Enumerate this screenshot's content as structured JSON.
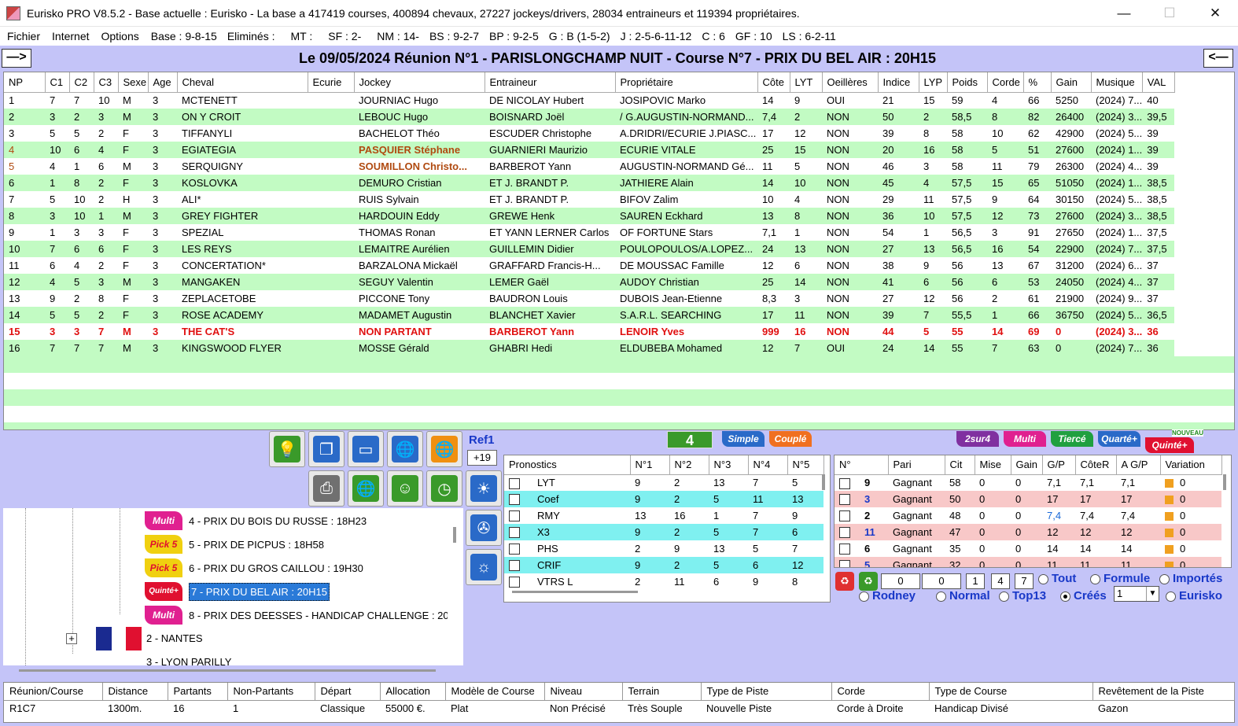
{
  "app": {
    "title": "Eurisko PRO V8.5.2 - Base actuelle : Eurisko - La base a 417419 courses, 400894 chevaux, 27227 jockeys/drivers, 28034 entraineurs et 119394 propriétaires.",
    "min": "—",
    "max": "☐",
    "close": "✕"
  },
  "menu": {
    "fichier": "Fichier",
    "internet": "Internet",
    "options": "Options",
    "stats": [
      "Base : 9-8-15",
      "Eliminés :",
      "MT :",
      "SF : 2-",
      "NM : 14-",
      "BS : 9-2-7",
      "BP : 9-2-5",
      "G : B (1-5-2)",
      "J : 2-5-6-11-12",
      "C : 6",
      "GF : 10",
      "LS : 6-2-11"
    ]
  },
  "race": {
    "prev": "—>",
    "next": "<—",
    "title": "Le 09/05/2024 Réunion N°1 - PARISLONGCHAMP NUIT - Course N°7 - PRIX DU BEL AIR : 20H15"
  },
  "grid": {
    "columns": [
      "NP",
      "C1",
      "C2",
      "C3",
      "Sexe",
      "Age",
      "Cheval",
      "Ecurie",
      "Jockey",
      "Entraineur",
      "Propriétaire",
      "Côte",
      "LYT",
      "Oeillères",
      "Indice",
      "LYP",
      "Poids",
      "Corde",
      "%",
      "Gain",
      "Musique",
      "VAL"
    ],
    "rows": [
      [
        "1",
        "7",
        "7",
        "10",
        "M",
        "3",
        "MCTENETT",
        "",
        "JOURNIAC Hugo",
        "DE NICOLAY Hubert",
        "JOSIPOVIC Marko",
        "14",
        "9",
        "OUI",
        "21",
        "15",
        "59",
        "4",
        "66",
        "5250",
        "(2024) 7...",
        "40"
      ],
      [
        "2",
        "3",
        "2",
        "3",
        "M",
        "3",
        "ON Y CROIT",
        "",
        "LEBOUC Hugo",
        "BOISNARD Joël",
        "/ G.AUGUSTIN-NORMAND...",
        "7,4",
        "2",
        "NON",
        "50",
        "2",
        "58,5",
        "8",
        "82",
        "26400",
        "(2024) 3...",
        "39,5"
      ],
      [
        "3",
        "5",
        "5",
        "2",
        "F",
        "3",
        "TIFFANYLI",
        "",
        "BACHELOT Théo",
        "ESCUDER Christophe",
        "A.DRIDRI/ECURIE J.PIASC...",
        "17",
        "12",
        "NON",
        "39",
        "8",
        "58",
        "10",
        "62",
        "42900",
        "(2024) 5...",
        "39"
      ],
      [
        "4",
        "10",
        "6",
        "4",
        "F",
        "3",
        "EGIATEGIA",
        "",
        "PASQUIER Stéphane",
        "GUARNIERI Maurizio",
        "ECURIE VITALE",
        "25",
        "15",
        "NON",
        "20",
        "16",
        "58",
        "5",
        "51",
        "27600",
        "(2024) 1...",
        "39"
      ],
      [
        "5",
        "4",
        "1",
        "6",
        "M",
        "3",
        "SERQUIGNY",
        "",
        "SOUMILLON Christo...",
        "BARBEROT Yann",
        "AUGUSTIN-NORMAND Gé...",
        "11",
        "5",
        "NON",
        "46",
        "3",
        "58",
        "11",
        "79",
        "26300",
        "(2024) 4...",
        "39"
      ],
      [
        "6",
        "1",
        "8",
        "2",
        "F",
        "3",
        "KOSLOVKA",
        "",
        "DEMURO Cristian",
        "ET J. BRANDT P.",
        "JATHIERE Alain",
        "14",
        "10",
        "NON",
        "45",
        "4",
        "57,5",
        "15",
        "65",
        "51050",
        "(2024) 1...",
        "38,5"
      ],
      [
        "7",
        "5",
        "10",
        "2",
        "H",
        "3",
        "ALI*",
        "",
        "RUIS Sylvain",
        "ET J. BRANDT P.",
        "BIFOV Zalim",
        "10",
        "4",
        "NON",
        "29",
        "11",
        "57,5",
        "9",
        "64",
        "30150",
        "(2024) 5...",
        "38,5"
      ],
      [
        "8",
        "3",
        "10",
        "1",
        "M",
        "3",
        "GREY FIGHTER",
        "",
        "HARDOUIN Eddy",
        "GREWE Henk",
        "SAUREN Eckhard",
        "13",
        "8",
        "NON",
        "36",
        "10",
        "57,5",
        "12",
        "73",
        "27600",
        "(2024) 3...",
        "38,5"
      ],
      [
        "9",
        "1",
        "3",
        "3",
        "F",
        "3",
        "SPEZIAL",
        "",
        "THOMAS Ronan",
        "ET YANN LERNER Carlos",
        "OF FORTUNE Stars",
        "7,1",
        "1",
        "NON",
        "54",
        "1",
        "56,5",
        "3",
        "91",
        "27650",
        "(2024) 1...",
        "37,5"
      ],
      [
        "10",
        "7",
        "6",
        "6",
        "F",
        "3",
        "LES REYS",
        "",
        "LEMAITRE Aurélien",
        "GUILLEMIN Didier",
        "POULOPOULOS/A.LOPEZ...",
        "24",
        "13",
        "NON",
        "27",
        "13",
        "56,5",
        "16",
        "54",
        "22900",
        "(2024) 7...",
        "37,5"
      ],
      [
        "11",
        "6",
        "4",
        "2",
        "F",
        "3",
        "CONCERTATION*",
        "",
        "BARZALONA Mickaël",
        "GRAFFARD Francis-H...",
        "DE MOUSSAC Famille",
        "12",
        "6",
        "NON",
        "38",
        "9",
        "56",
        "13",
        "67",
        "31200",
        "(2024) 6...",
        "37"
      ],
      [
        "12",
        "4",
        "5",
        "3",
        "M",
        "3",
        "MANGAKEN",
        "",
        "SEGUY Valentin",
        "LEMER Gaël",
        "AUDOY Christian",
        "25",
        "14",
        "NON",
        "41",
        "6",
        "56",
        "6",
        "53",
        "24050",
        "(2024) 4...",
        "37"
      ],
      [
        "13",
        "9",
        "2",
        "8",
        "F",
        "3",
        "ZEPLACETOBE",
        "",
        "PICCONE Tony",
        "BAUDRON Louis",
        "DUBOIS Jean-Etienne",
        "8,3",
        "3",
        "NON",
        "27",
        "12",
        "56",
        "2",
        "61",
        "21900",
        "(2024) 9...",
        "37"
      ],
      [
        "14",
        "5",
        "5",
        "2",
        "F",
        "3",
        "ROSE ACADEMY",
        "",
        "MADAMET Augustin",
        "BLANCHET Xavier",
        "S.A.R.L. SEARCHING",
        "17",
        "11",
        "NON",
        "39",
        "7",
        "55,5",
        "1",
        "66",
        "36750",
        "(2024) 5...",
        "36,5"
      ],
      [
        "15",
        "3",
        "3",
        "7",
        "M",
        "3",
        "THE CAT'S",
        "",
        "NON PARTANT",
        "BARBEROT Yann",
        "LENOIR Yves",
        "999",
        "16",
        "NON",
        "44",
        "5",
        "55",
        "14",
        "69",
        "0",
        "(2024) 3...",
        "36"
      ],
      [
        "16",
        "7",
        "7",
        "7",
        "M",
        "3",
        "KINGSWOOD FLYER",
        "",
        "MOSSE Gérald",
        "GHABRI Hedi",
        "ELDUBEBA Mohamed",
        "12",
        "7",
        "OUI",
        "24",
        "14",
        "55",
        "7",
        "63",
        "0",
        "(2024) 7...",
        "36"
      ]
    ]
  },
  "ref": {
    "label": "Ref1",
    "value": "+19"
  },
  "bets": {
    "four": "4",
    "simple": "Simple",
    "couple": "Couplé",
    "deuxsur4": "2sur4",
    "multi": "Multi",
    "tierce": "Tiercé",
    "quarte": "Quarté+",
    "quinte": "Quinté+",
    "nouveau": "NOUVEAU"
  },
  "tree": {
    "items": [
      {
        "badge": "Multi",
        "label": "4 - PRIX DU BOIS DU RUSSE : 18H23"
      },
      {
        "badge": "Pick 5",
        "label": "5 - PRIX DE PICPUS : 18H58"
      },
      {
        "badge": "Pick 5",
        "label": "6 - PRIX DU GROS CAILLOU : 19H30"
      },
      {
        "badge": "Quinté+",
        "label": "7 - PRIX DU BEL AIR : 20H15"
      },
      {
        "badge": "Multi",
        "label": "8 - PRIX DES DEESSES - HANDICAP CHALLENGE : 20"
      }
    ],
    "meetings": [
      "2 - NANTES",
      "3 - LYON PARILLY"
    ],
    "expander": "+"
  },
  "prono": {
    "columns": [
      "Pronostics",
      "N°1",
      "N°2",
      "N°3",
      "N°4",
      "N°5"
    ],
    "rows": [
      [
        "LYT",
        "9",
        "2",
        "13",
        "7",
        "5"
      ],
      [
        "Coef",
        "9",
        "2",
        "5",
        "11",
        "13"
      ],
      [
        "RMY",
        "13",
        "16",
        "1",
        "7",
        "9"
      ],
      [
        "X3",
        "9",
        "2",
        "5",
        "7",
        "6"
      ],
      [
        "PHS",
        "2",
        "9",
        "13",
        "5",
        "7"
      ],
      [
        "CRIF",
        "9",
        "2",
        "5",
        "6",
        "12"
      ],
      [
        "VTRS L",
        "2",
        "11",
        "6",
        "9",
        "8"
      ]
    ]
  },
  "paris": {
    "columns": [
      "N°",
      "Pari",
      "Cit",
      "Mise",
      "Gain",
      "G/P",
      "CôteR",
      "A G/P",
      "Variation"
    ],
    "rows": [
      [
        "9",
        "Gagnant",
        "58",
        "0",
        "0",
        "7,1",
        "7,1",
        "7,1",
        "0"
      ],
      [
        "3",
        "Gagnant",
        "50",
        "0",
        "0",
        "17",
        "17",
        "17",
        "0"
      ],
      [
        "2",
        "Gagnant",
        "48",
        "0",
        "0",
        "7,4",
        "7,4",
        "7,4",
        "0"
      ],
      [
        "11",
        "Gagnant",
        "47",
        "0",
        "0",
        "12",
        "12",
        "12",
        "0"
      ],
      [
        "6",
        "Gagnant",
        "35",
        "0",
        "0",
        "14",
        "14",
        "14",
        "0"
      ],
      [
        "5",
        "Gagnant",
        "32",
        "0",
        "0",
        "11",
        "11",
        "11",
        "0"
      ]
    ]
  },
  "controls": {
    "v1": "0",
    "v2": "0",
    "v3": "1",
    "v4": "4",
    "v5": "7",
    "tout": "Tout",
    "formule": "Formule",
    "importes": "Importés",
    "rodney": "Rodney",
    "normal": "Normal",
    "top13": "Top13",
    "crees": "Créés",
    "select": "1",
    "eurisko": "Eurisko"
  },
  "info": {
    "columns": [
      "Réunion/Course",
      "Distance",
      "Partants",
      "Non-Partants",
      "Départ",
      "Allocation",
      "Modèle de Course",
      "Niveau",
      "Terrain",
      "Type de Piste",
      "Corde",
      "Type de Course",
      "Revêtement de la Piste"
    ],
    "values": [
      "R1C7",
      "1300m.",
      "16",
      "1",
      "Classique",
      "55000 €.",
      "Plat",
      "Non Précisé",
      "Très Souple",
      "Nouvelle Piste",
      "Corde à Droite",
      "Handicap Divisé",
      "Gazon"
    ]
  },
  "colors": {
    "green_row": "#c2fbc3",
    "cyan_row": "#7ff0f0",
    "pink_row": "#f8c8c8",
    "highlight_jockey": "#b04a10",
    "nonpartant": "#e01010",
    "panel_bg": "#c4c4f8"
  }
}
